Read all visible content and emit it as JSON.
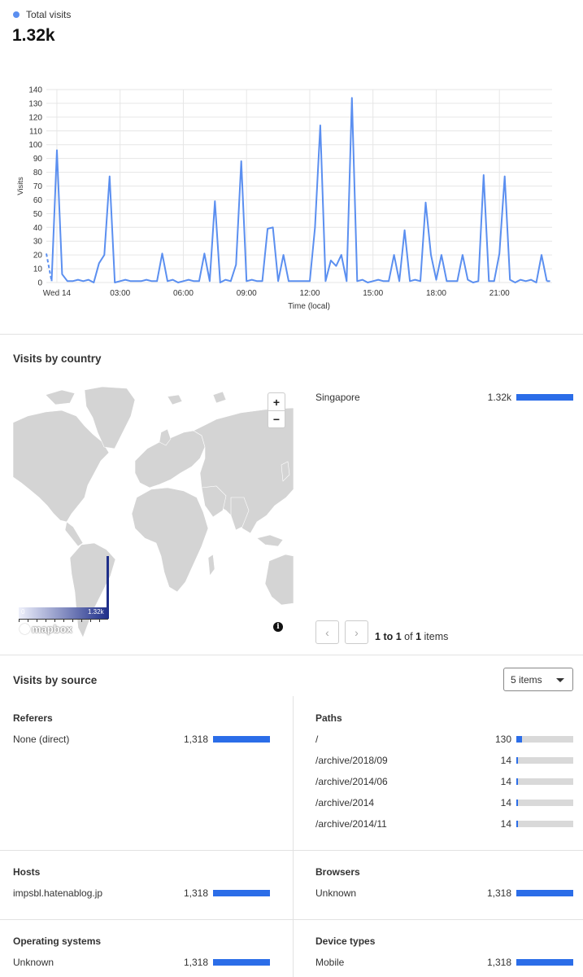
{
  "visits": {
    "legend_label": "Total visits",
    "total": "1.32k",
    "series_color": "#5b8ff0"
  },
  "chart_data": {
    "type": "line",
    "title": "",
    "xlabel": "Time (local)",
    "ylabel": "Visits",
    "ylim": [
      0,
      140
    ],
    "yticks": [
      0,
      10,
      20,
      30,
      40,
      50,
      60,
      70,
      80,
      90,
      100,
      110,
      120,
      130,
      140
    ],
    "xticks": [
      "Wed 14",
      "03:00",
      "06:00",
      "09:00",
      "12:00",
      "15:00",
      "18:00",
      "21:00"
    ],
    "xtick_hours": [
      0,
      3,
      6,
      9,
      12,
      15,
      18,
      21
    ],
    "xlim_hours": [
      -0.5,
      23.5
    ],
    "grid": true,
    "series": [
      {
        "hours": [
          -0.5,
          -0.25,
          0,
          0.25,
          0.5,
          0.75,
          1,
          1.25,
          1.5,
          1.75,
          2,
          2.25,
          2.5,
          2.75,
          3,
          3.25,
          3.5,
          3.75,
          4,
          4.25,
          4.5,
          4.75,
          5,
          5.25,
          5.5,
          5.75,
          6,
          6.25,
          6.5,
          6.75,
          7,
          7.25,
          7.5,
          7.75,
          8,
          8.25,
          8.5,
          8.75,
          9,
          9.25,
          9.5,
          9.75,
          10,
          10.25,
          10.5,
          10.75,
          11,
          11.25,
          11.5,
          11.75,
          12,
          12.25,
          12.5,
          12.75,
          13,
          13.25,
          13.5,
          13.75,
          14,
          14.25,
          14.5,
          14.75,
          15,
          15.25,
          15.5,
          15.75,
          16,
          16.25,
          16.5,
          16.75,
          17,
          17.25,
          17.5,
          17.75,
          18,
          18.25,
          18.5,
          18.75,
          19,
          19.25,
          19.5,
          19.75,
          20,
          20.25,
          20.5,
          20.75,
          21,
          21.25,
          21.5,
          21.75,
          22,
          22.25,
          22.5,
          22.75,
          23,
          23.25,
          23.5
        ],
        "values": [
          21,
          1,
          96,
          6,
          1,
          1,
          2,
          1,
          2,
          0,
          14,
          20,
          77,
          0,
          1,
          2,
          1,
          1,
          1,
          2,
          1,
          1,
          21,
          1,
          2,
          0,
          1,
          2,
          1,
          1,
          21,
          1,
          59,
          0,
          2,
          1,
          13,
          88,
          1,
          2,
          1,
          1,
          39,
          40,
          1,
          20,
          1,
          1,
          1,
          1,
          1,
          40,
          114,
          1,
          16,
          12,
          20,
          1,
          134,
          1,
          2,
          0,
          1,
          2,
          1,
          1,
          20,
          1,
          38,
          1,
          2,
          1,
          58,
          20,
          2,
          20,
          1,
          1,
          1,
          20,
          2,
          0,
          1,
          78,
          1,
          1,
          21,
          77,
          2,
          0,
          2,
          1,
          2,
          0,
          20,
          1,
          1
        ],
        "dashed_segments": [
          [
            0,
            1
          ],
          [
            95,
            96
          ]
        ]
      }
    ]
  },
  "country": {
    "title": "Visits by country",
    "zoom_in": "+",
    "zoom_out": "−",
    "colorbar_min": "0",
    "colorbar_max": "1.32k",
    "mapbox_label": "mapbox",
    "info_icon": "i",
    "rows": [
      {
        "label": "Singapore",
        "value": "1.32k",
        "fraction": 1.0
      }
    ],
    "pager": {
      "prev": "‹",
      "next": "›",
      "range_from": "1",
      "range_to_word": "to",
      "range_to": "1",
      "of_word": "of",
      "total": "1",
      "items_word": "items"
    }
  },
  "source": {
    "title": "Visits by source",
    "select_value": "5 items",
    "referers": {
      "title": "Referers",
      "rows": [
        {
          "label": "None (direct)",
          "value": "1,318",
          "fraction": 1.0
        }
      ]
    },
    "paths": {
      "title": "Paths",
      "rows": [
        {
          "label": "/",
          "value": "130",
          "fraction": 0.1
        },
        {
          "label": "/archive/2018/09",
          "value": "14",
          "fraction": 0.02
        },
        {
          "label": "/archive/2014/06",
          "value": "14",
          "fraction": 0.02
        },
        {
          "label": "/archive/2014",
          "value": "14",
          "fraction": 0.02
        },
        {
          "label": "/archive/2014/11",
          "value": "14",
          "fraction": 0.02
        }
      ]
    },
    "hosts": {
      "title": "Hosts",
      "rows": [
        {
          "label": "impsbl.hatenablog.jp",
          "value": "1,318",
          "fraction": 1.0
        }
      ]
    },
    "browsers": {
      "title": "Browsers",
      "rows": [
        {
          "label": "Unknown",
          "value": "1,318",
          "fraction": 1.0
        }
      ]
    },
    "operating_systems": {
      "title": "Operating systems",
      "rows": [
        {
          "label": "Unknown",
          "value": "1,318",
          "fraction": 1.0
        }
      ]
    },
    "device_types": {
      "title": "Device types",
      "rows": [
        {
          "label": "Mobile",
          "value": "1,318",
          "fraction": 1.0
        }
      ]
    }
  },
  "colors": {
    "bar_fill": "#2b6de8",
    "bar_track": "#d9d9d9",
    "land": "#d4d4d4"
  }
}
